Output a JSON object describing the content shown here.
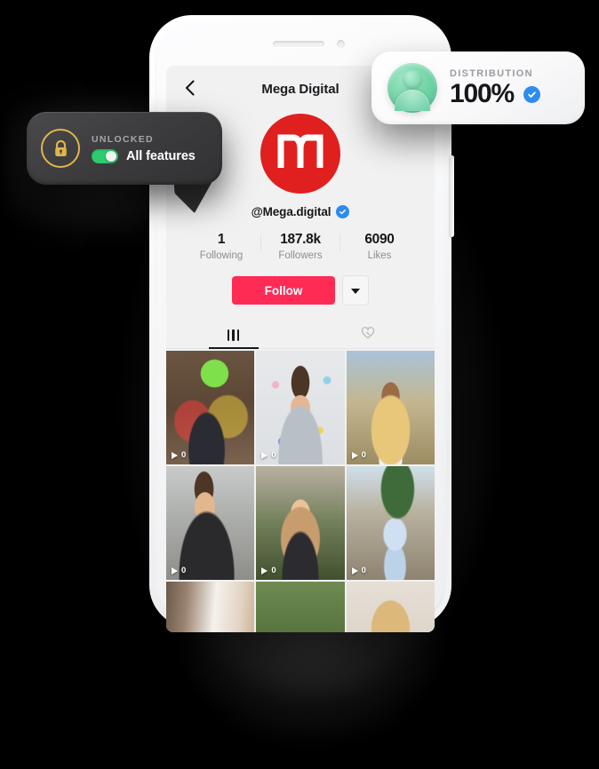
{
  "app": {
    "header": {
      "back_icon": "chevron-left-icon",
      "title": "Mega Digital"
    },
    "profile": {
      "logo_letter": "M",
      "logo_color": "#e0201f",
      "handle": "@Mega.digital",
      "verified_icon": "verified-check-icon",
      "verified_color": "#2d8cf0"
    },
    "stats": [
      {
        "value": "1",
        "label": "Following"
      },
      {
        "value": "187.8k",
        "label": "Followers"
      },
      {
        "value": "6090",
        "label": "Likes"
      }
    ],
    "actions": {
      "follow_label": "Follow",
      "follow_color": "#fe2c55",
      "more_icon": "chevron-down-icon"
    },
    "tabs": [
      {
        "name": "videos",
        "icon": "grid-bars-icon",
        "active": true
      },
      {
        "name": "liked",
        "icon": "heart-slash-icon",
        "active": false
      }
    ],
    "grid": [
      {
        "alt": "graffiti-wall-portrait",
        "plays": "0"
      },
      {
        "alt": "confetti-teen-portrait",
        "plays": "0"
      },
      {
        "alt": "braids-sunglasses-portrait",
        "plays": "0"
      },
      {
        "alt": "stairs-jacket-portrait",
        "plays": "0"
      },
      {
        "alt": "blonde-outdoor-portrait",
        "plays": "0"
      },
      {
        "alt": "palm-tree-hoodie-portrait",
        "plays": "0"
      },
      {
        "alt": "doorway-portrait",
        "plays": ""
      },
      {
        "alt": "tree-smile-portrait",
        "plays": ""
      },
      {
        "alt": "hair-clips-portrait",
        "plays": ""
      }
    ]
  },
  "unlocked_card": {
    "lock_icon": "lock-icon",
    "lock_color": "#e3b44a",
    "title": "UNLOCKED",
    "toggle_on": true,
    "toggle_color": "#2ecc71",
    "feature_label": "All features"
  },
  "distribution_card": {
    "avatar_icon": "person-icon",
    "avatar_color": "#74d5a8",
    "title": "DISTRIBUTION",
    "value": "100%",
    "verified_icon": "verified-check-icon",
    "verified_color": "#2d8cf0"
  }
}
